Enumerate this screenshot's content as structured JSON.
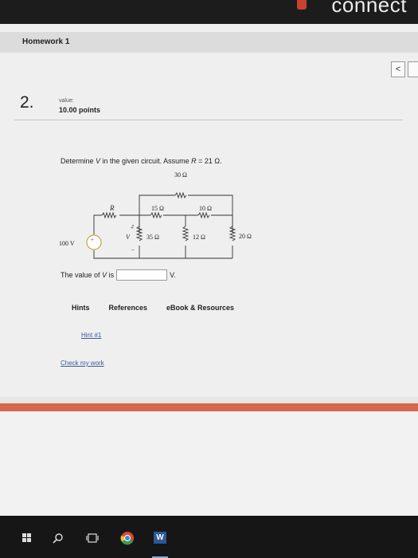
{
  "brand": {
    "name": "connect"
  },
  "header": {
    "title": "Homework 1",
    "prev_label": "<"
  },
  "question": {
    "number": "2.",
    "value_label": "value:",
    "points": "10.00 points",
    "prompt_prefix": "Determine ",
    "prompt_var": "V",
    "prompt_mid": " in the given circuit. Assume ",
    "prompt_r": "R",
    "prompt_rest": " = 21 Ω.",
    "answer_prefix": "The value of ",
    "answer_var": "V",
    "answer_mid": " is",
    "answer_unit": "V.",
    "answer_value": ""
  },
  "circuit": {
    "source": "100 V",
    "source_sign": "+",
    "r_label": "R",
    "r1": "15 Ω",
    "r2": "10 Ω",
    "r_top": "30 Ω",
    "r_v": "35 Ω",
    "r_mid": "12 Ω",
    "r_right": "20 Ω",
    "v_label": "V",
    "v_plus": "+",
    "v_minus": "–"
  },
  "tabs": [
    {
      "label": "Hints"
    },
    {
      "label": "References"
    },
    {
      "label": "eBook & Resources"
    }
  ],
  "links": {
    "hint": "Hint #1",
    "check": "Check my work"
  },
  "taskbar": {
    "icons": [
      "windows-start-icon",
      "search-icon",
      "task-view-icon",
      "chrome-icon",
      "word-icon"
    ],
    "word_letter": "W"
  },
  "colors": {
    "accent_band": "#d2694a",
    "link": "#3a5a9a",
    "source_circle": "#c9a23a"
  }
}
